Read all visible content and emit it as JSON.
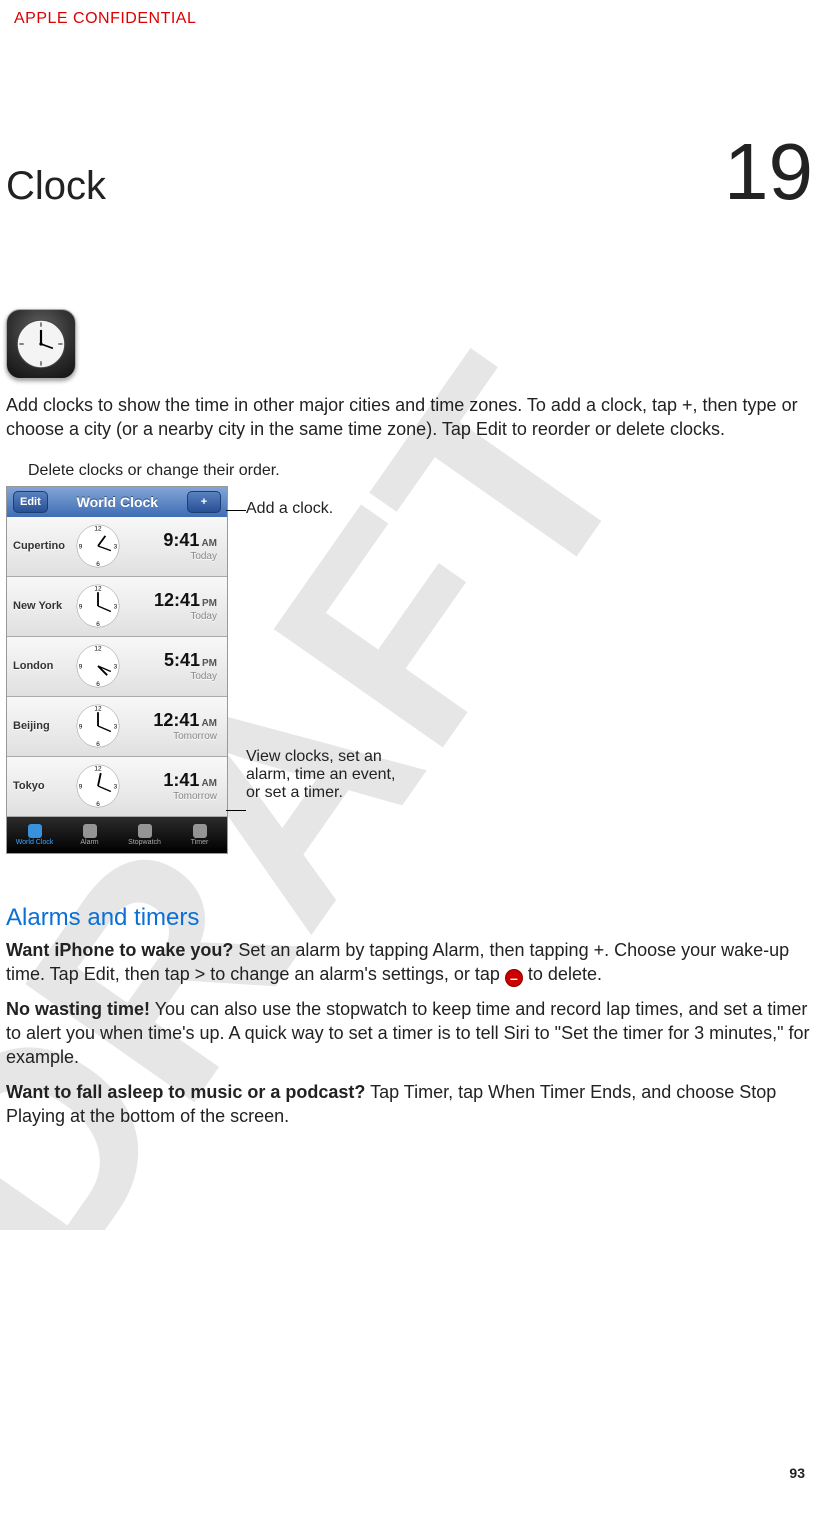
{
  "header": {
    "confidential": "APPLE CONFIDENTIAL",
    "chapter_title": "Clock",
    "chapter_number": "19"
  },
  "intro": "Add clocks to show the time in other major cities and time zones. To add a clock, tap +, then type or choose a city (or a nearby city in the same time zone). Tap Edit to reorder or delete clocks.",
  "callouts": {
    "top": "Delete clocks or change their order.",
    "add": "Add a clock.",
    "bottom": "View clocks, set an alarm, time an event, or set a timer."
  },
  "navbar": {
    "edit": "Edit",
    "title": "World Clock",
    "add": "+"
  },
  "clocks": [
    {
      "city": "Cupertino",
      "time": "9:41",
      "ampm": "AM",
      "day": "Today"
    },
    {
      "city": "New York",
      "time": "12:41",
      "ampm": "PM",
      "day": "Today"
    },
    {
      "city": "London",
      "time": "5:41",
      "ampm": "PM",
      "day": "Today"
    },
    {
      "city": "Beijing",
      "time": "12:41",
      "ampm": "AM",
      "day": "Tomorrow"
    },
    {
      "city": "Tokyo",
      "time": "1:41",
      "ampm": "AM",
      "day": "Tomorrow"
    }
  ],
  "tabs": [
    {
      "label": "World Clock"
    },
    {
      "label": "Alarm"
    },
    {
      "label": "Stopwatch"
    },
    {
      "label": "Timer"
    }
  ],
  "section": {
    "heading": "Alarms and timers",
    "p1_strong": "Want iPhone to wake you?",
    "p1_a": " Set an alarm by tapping Alarm, then tapping +. Choose your wake-up time. Tap Edit, then tap > to change an alarm's settings, or tap ",
    "p1_b": " to delete.",
    "p2_strong": "No wasting time!",
    "p2": " You can also use the stopwatch to keep time and record lap times, and set a timer to alert you when time's up. A quick way to set a timer is to tell Siri to \"Set the timer for 3 minutes,\" for example.",
    "p3_strong": "Want to fall asleep to music or a podcast?",
    "p3": " Tap Timer, tap When Timer Ends, and choose Stop Playing at the bottom of the screen."
  },
  "page_number": "93",
  "watermark": "DRAFT"
}
